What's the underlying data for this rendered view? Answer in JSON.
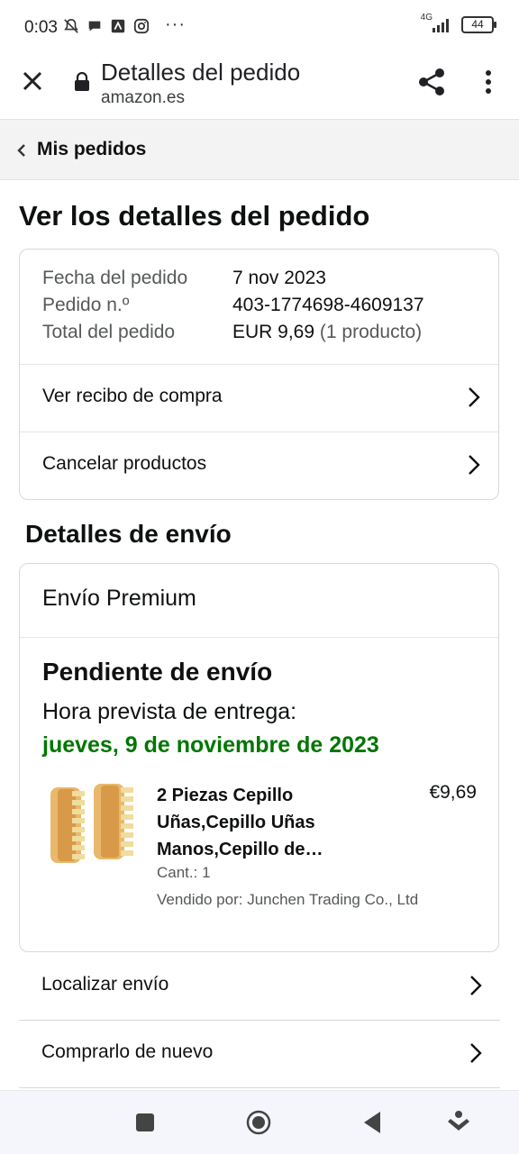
{
  "status_bar": {
    "time": "0:03",
    "network": "4G",
    "battery": "44",
    "overflow": "···",
    "icons": [
      "bell-off-icon",
      "chat-icon",
      "app-icon",
      "instagram-icon",
      "signal-icon",
      "battery-icon"
    ]
  },
  "browser": {
    "title": "Detalles del pedido",
    "url": "amazon.es",
    "icons": [
      "close-icon",
      "lock-icon",
      "share-icon",
      "more-vert-icon"
    ]
  },
  "breadcrumb": {
    "label": "Mis pedidos"
  },
  "page_title": "Ver los detalles del pedido",
  "order": {
    "date_label": "Fecha del pedido",
    "date_value": "7 nov 2023",
    "number_label": "Pedido n.º",
    "number_value": "403-1774698-4609137",
    "total_label": "Total del pedido",
    "total_value": "EUR 9,69",
    "total_count": "(1 producto)",
    "links": [
      "Ver recibo de compra",
      "Cancelar productos"
    ]
  },
  "shipping": {
    "section_title": "Detalles de envío",
    "type": "Envío Premium",
    "status": "Pendiente de envío",
    "eta_label": "Hora prevista de entrega:",
    "eta_date": "jueves, 9 de noviembre de 2023",
    "product": {
      "title": "2 Piezas Cepillo Uñas,Cepillo Uñas Manos,Cepillo de…",
      "price": "€9,69",
      "qty": "Cant.: 1",
      "seller": "Vendido por: Junchen Trading Co., Ltd"
    }
  },
  "actions": [
    "Localizar envío",
    "Comprarlo de nuevo"
  ],
  "nav_bar": {
    "icons": [
      "square-icon",
      "home-circle-icon",
      "back-icon",
      "download-icon"
    ]
  },
  "colors": {
    "eta_green": "#007600",
    "muted": "#565959",
    "border": "#d5d9d9"
  }
}
